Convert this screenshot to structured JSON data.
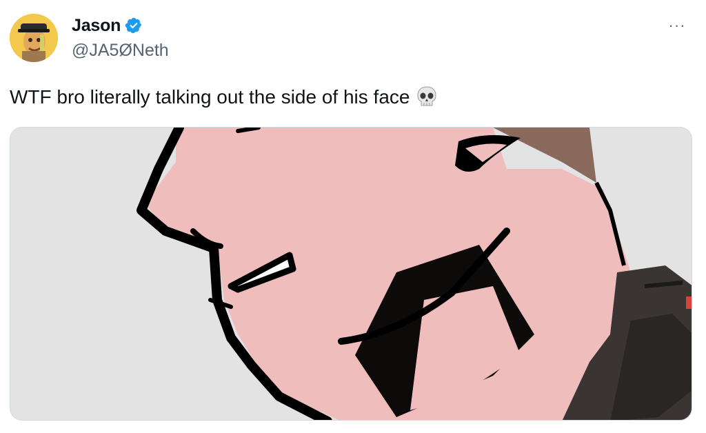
{
  "author": {
    "display_name": "Jason",
    "handle": "@JA5ØNeth",
    "verified": true,
    "verified_color": "#1d9bf0"
  },
  "tweet": {
    "text": "WTF bro literally talking out the side of his face",
    "emoji": "skull-icon"
  },
  "more_menu": {
    "label": "···"
  },
  "colors": {
    "skin": "#efbdbc",
    "outline": "#000000",
    "background_gray": "#e3e3e3",
    "handle_gray": "#536471"
  }
}
